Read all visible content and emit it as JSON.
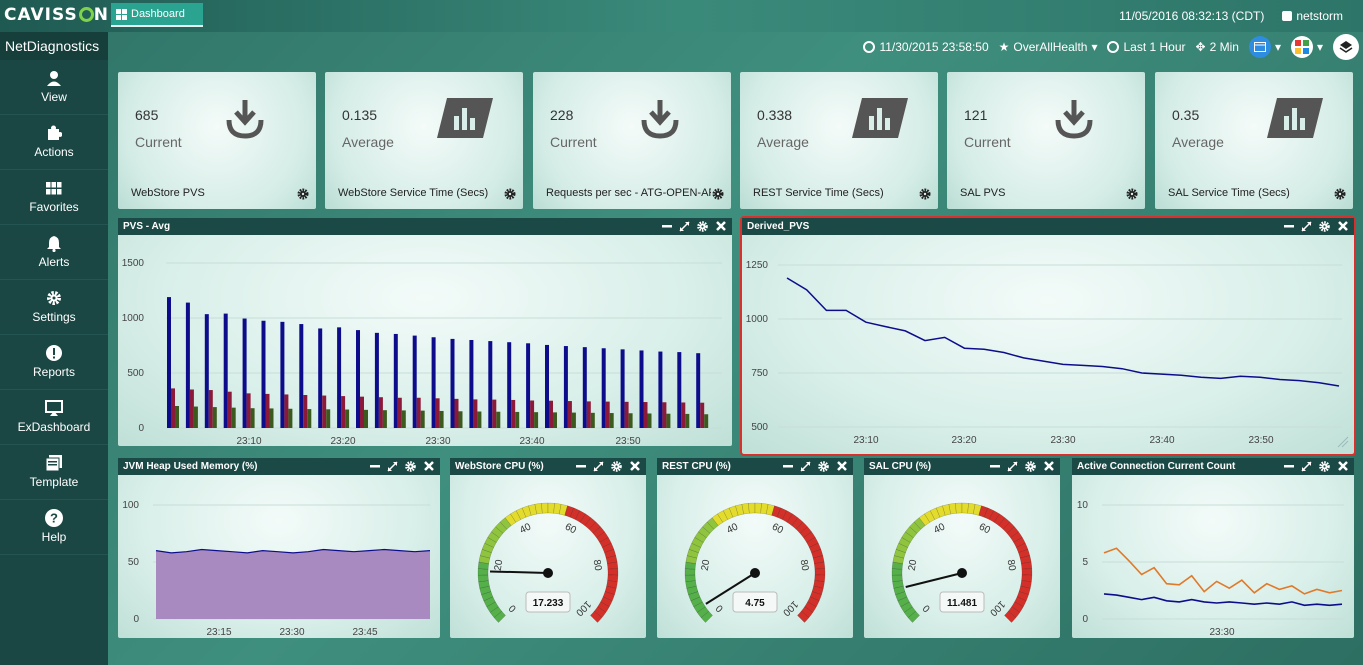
{
  "brand": {
    "logo_text": "CAVISS",
    "logo_tail": "N",
    "dashboard_tab": "Dashboard",
    "app_name": "NetDiagnostics"
  },
  "header": {
    "datetime": "11/05/2016 08:32:13 (CDT)",
    "user": "netstorm"
  },
  "toolbar": {
    "snapshot_time": "11/30/2015 23:58:50",
    "favorite": "OverAllHealth",
    "range": "Last 1 Hour",
    "interval": "2 Min"
  },
  "sidebar": {
    "items": [
      {
        "label": "View",
        "icon": "user-icon"
      },
      {
        "label": "Actions",
        "icon": "puzzle-icon"
      },
      {
        "label": "Favorites",
        "icon": "grid-icon"
      },
      {
        "label": "Alerts",
        "icon": "bell-icon"
      },
      {
        "label": "Settings",
        "icon": "gear-icon"
      },
      {
        "label": "Reports",
        "icon": "exclamation-icon"
      },
      {
        "label": "ExDashboard",
        "icon": "monitor-icon"
      },
      {
        "label": "Template",
        "icon": "template-icon"
      },
      {
        "label": "Help",
        "icon": "help-icon"
      }
    ]
  },
  "cards": [
    {
      "value": "685",
      "label": "Current",
      "name": "WebStore PVS",
      "icon": "download-icon"
    },
    {
      "value": "0.135",
      "label": "Average",
      "name": "WebStore Service Time (Secs)",
      "icon": "bar-chart-icon"
    },
    {
      "value": "228",
      "label": "Current",
      "name": "Requests per sec - ATG-OPEN-API-ECS",
      "icon": "download-icon"
    },
    {
      "value": "0.338",
      "label": "Average",
      "name": "REST Service Time (Secs)",
      "icon": "bar-chart-icon"
    },
    {
      "value": "121",
      "label": "Current",
      "name": "SAL PVS",
      "icon": "download-icon"
    },
    {
      "value": "0.35",
      "label": "Average",
      "name": "SAL Service Time (Secs)",
      "icon": "bar-chart-icon"
    }
  ],
  "panels": {
    "pvs_avg": "PVS - Avg",
    "derived_pvs": "Derived_PVS",
    "jvm_heap": "JVM Heap Used Memory (%)",
    "webstore_cpu": "WebStore CPU (%)",
    "rest_cpu": "REST CPU (%)",
    "sal_cpu": "SAL CPU (%)",
    "active_conn": "Active Connection Current Count"
  },
  "colors": {
    "series_blue": "#0d0d8c",
    "series_red": "#8b1a3a",
    "series_green": "#3d5a1e",
    "line_orange": "#e07a2a",
    "heap_fill": "#a98ac0",
    "highlight": "#d9302e"
  },
  "chart_data": [
    {
      "type": "bar",
      "title": "PVS - Avg",
      "ylim": [
        0,
        1500
      ],
      "yticks": [
        0,
        500,
        1000,
        1500
      ],
      "xticks": [
        "23:10",
        "23:20",
        "23:30",
        "23:40",
        "23:50"
      ],
      "series": [
        {
          "values": [
            1190,
            1140,
            1035,
            1040,
            995,
            975,
            965,
            945,
            905,
            915,
            890,
            865,
            855,
            840,
            825,
            810,
            800,
            790,
            780,
            770,
            755,
            745,
            735,
            725,
            715,
            705,
            695,
            690,
            680
          ]
        },
        {
          "values": [
            360,
            350,
            345,
            330,
            315,
            310,
            305,
            300,
            295,
            290,
            285,
            280,
            275,
            275,
            270,
            265,
            260,
            258,
            255,
            250,
            248,
            245,
            242,
            240,
            238,
            236,
            234,
            232,
            230
          ]
        },
        {
          "values": [
            200,
            195,
            190,
            185,
            180,
            178,
            175,
            172,
            170,
            168,
            165,
            162,
            160,
            158,
            155,
            152,
            150,
            148,
            146,
            144,
            142,
            140,
            138,
            136,
            134,
            132,
            130,
            128,
            125
          ]
        }
      ]
    },
    {
      "type": "line",
      "title": "Derived_PVS",
      "ylim": [
        500,
        1250
      ],
      "yticks": [
        500,
        750,
        1000,
        1250
      ],
      "xticks": [
        "23:10",
        "23:20",
        "23:30",
        "23:40",
        "23:50"
      ],
      "series": [
        {
          "values": [
            1190,
            1135,
            1040,
            1040,
            985,
            965,
            945,
            900,
            915,
            865,
            860,
            845,
            820,
            805,
            790,
            785,
            780,
            770,
            750,
            745,
            740,
            730,
            725,
            735,
            730,
            720,
            715,
            705,
            690
          ]
        }
      ]
    },
    {
      "type": "area",
      "title": "JVM Heap Used Memory (%)",
      "ylim": [
        0,
        100
      ],
      "yticks": [
        0,
        50,
        100
      ],
      "xticks": [
        "23:15",
        "23:30",
        "23:45"
      ],
      "series": [
        {
          "values": [
            60,
            58,
            59,
            61,
            60,
            59,
            58,
            60,
            59,
            58,
            59,
            61,
            60,
            59,
            60,
            61,
            60,
            59,
            60
          ]
        }
      ]
    },
    {
      "type": "gauge",
      "title": "WebStore CPU (%)",
      "value": 17.233,
      "min": 0,
      "max": 100,
      "ticks": [
        0,
        20,
        40,
        60,
        80,
        100
      ]
    },
    {
      "type": "gauge",
      "title": "REST CPU (%)",
      "value": 4.75,
      "min": 0,
      "max": 100,
      "ticks": [
        0,
        20,
        40,
        60,
        80,
        100
      ]
    },
    {
      "type": "gauge",
      "title": "SAL CPU (%)",
      "value": 11.481,
      "min": 0,
      "max": 100,
      "ticks": [
        0,
        20,
        40,
        60,
        80,
        100
      ]
    },
    {
      "type": "line",
      "title": "Active Connection Current Count",
      "ylim": [
        0,
        10
      ],
      "yticks": [
        0,
        5,
        10
      ],
      "xticks": [
        "23:30"
      ],
      "series": [
        {
          "color": "#e07a2a",
          "values": [
            5.8,
            6.2,
            5.1,
            3.9,
            4.5,
            3.1,
            3.0,
            3.8,
            2.4,
            3.3,
            2.7,
            3.4,
            2.3,
            3.1,
            2.6,
            2.9,
            2.2,
            2.6,
            2.3,
            2.5
          ]
        },
        {
          "color": "#0d0d8c",
          "values": [
            2.2,
            2.1,
            1.9,
            1.7,
            1.9,
            1.6,
            1.5,
            1.7,
            1.5,
            1.4,
            1.5,
            1.4,
            1.3,
            1.4,
            1.3,
            1.5,
            1.2,
            1.3,
            1.2,
            1.3
          ]
        }
      ]
    }
  ]
}
